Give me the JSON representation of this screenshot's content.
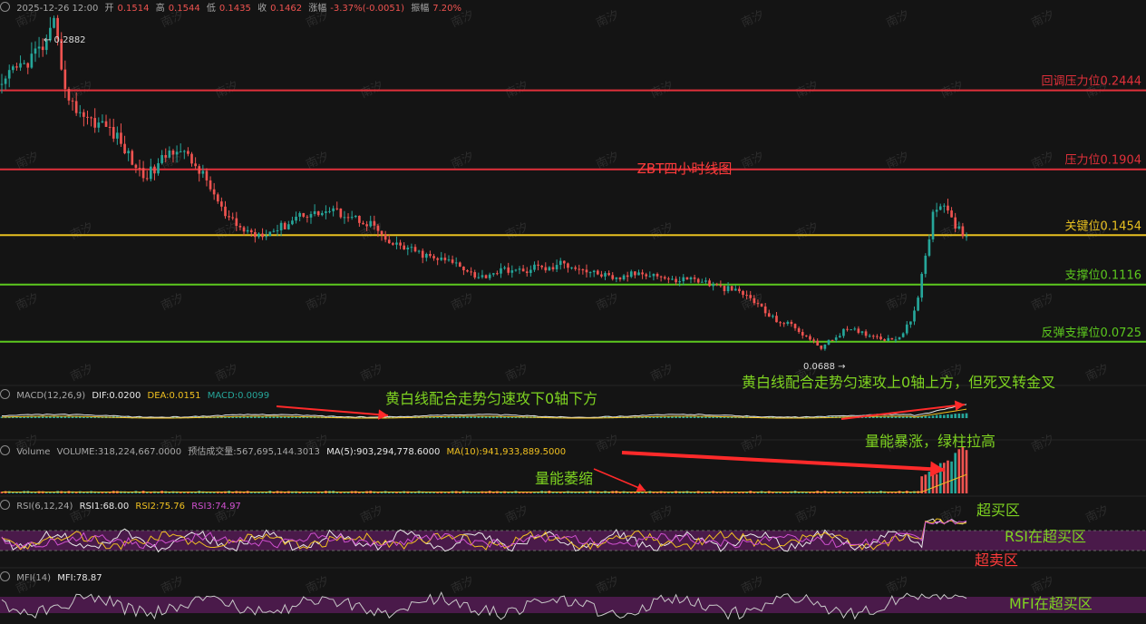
{
  "header": {
    "date": "2025-12-26 12:00",
    "open_label": "开",
    "open": "0.1514",
    "high_label": "高",
    "high": "0.1544",
    "low_label": "低",
    "low": "0.1435",
    "close_label": "收",
    "close": "0.1462",
    "change_label": "涨幅",
    "change": "-3.37%(-0.0051)",
    "amplitude_label": "振幅",
    "amplitude": "7.20%"
  },
  "title": "ZBT四小时线图",
  "watermark": "南汐",
  "price_marks": {
    "high_label": "0.2882",
    "low_label": "0.0688"
  },
  "levels": [
    {
      "label": "回调压力位0.2444",
      "value": 0.2444,
      "color": "#e0303a"
    },
    {
      "label": "压力位0.1904",
      "value": 0.1904,
      "color": "#e0303a"
    },
    {
      "label": "关键位0.1454",
      "value": 0.1454,
      "color": "#e8c020"
    },
    {
      "label": "支撑位0.1116",
      "value": 0.1116,
      "color": "#5cc81e"
    },
    {
      "label": "反弹支撑位0.0725",
      "value": 0.0725,
      "color": "#5cc81e"
    }
  ],
  "macd": {
    "name": "MACD(12,26,9)",
    "dif": "DIF:0.0200",
    "dea": "DEA:0.0151",
    "macd": "MACD:0.0099"
  },
  "volume": {
    "name": "Volume",
    "volume": "VOLUME:318,224,667.0000",
    "est": "预估成交量:567,695,144.3013",
    "ma5": "MA(5):903,294,778.6000",
    "ma10": "MA(10):941,933,889.5000"
  },
  "rsi": {
    "name": "RSI(6,12,24)",
    "rsi1": "RSI1:68.00",
    "rsi2": "RSI2:75.76",
    "rsi3": "RSI3:74.97"
  },
  "mfi": {
    "name": "MFI(14)",
    "mfi": "MFI:78.87"
  },
  "annotations": {
    "macd_left": "黄白线配合走势匀速攻下0轴下方",
    "macd_right": "黄白线配合走势匀速攻上0轴上方，但死叉转金叉",
    "vol_up": "量能暴涨，绿柱拉高",
    "vol_down": "量能萎缩",
    "overbought": "超买区",
    "rsi_over": "RSI在超买区",
    "oversold": "超卖区",
    "mfi_over": "MFI在超买区"
  },
  "colors": {
    "up": "#26a69a",
    "down": "#ef5350",
    "annotation_green": "#7ed321",
    "arrow_red": "#ff2a2a",
    "zone_purple": "#4a1a4a"
  },
  "chart_data": {
    "type": "candlestick",
    "ylim": [
      0.055,
      0.3
    ],
    "close_path": [
      [
        0,
        0.245
      ],
      [
        3,
        0.258
      ],
      [
        6,
        0.262
      ],
      [
        9,
        0.27
      ],
      [
        12,
        0.276
      ],
      [
        14,
        0.2882
      ],
      [
        16,
        0.262
      ],
      [
        18,
        0.236
      ],
      [
        21,
        0.23
      ],
      [
        24,
        0.224
      ],
      [
        28,
        0.22
      ],
      [
        31,
        0.212
      ],
      [
        35,
        0.196
      ],
      [
        38,
        0.186
      ],
      [
        41,
        0.19
      ],
      [
        44,
        0.2
      ],
      [
        47,
        0.206
      ],
      [
        50,
        0.198
      ],
      [
        53,
        0.19
      ],
      [
        56,
        0.178
      ],
      [
        60,
        0.158
      ],
      [
        64,
        0.15
      ],
      [
        68,
        0.146
      ],
      [
        72,
        0.148
      ],
      [
        76,
        0.152
      ],
      [
        80,
        0.16
      ],
      [
        84,
        0.16
      ],
      [
        88,
        0.162
      ],
      [
        92,
        0.16
      ],
      [
        96,
        0.156
      ],
      [
        100,
        0.152
      ],
      [
        103,
        0.14
      ],
      [
        107,
        0.138
      ],
      [
        111,
        0.134
      ],
      [
        115,
        0.13
      ],
      [
        119,
        0.128
      ],
      [
        122,
        0.126
      ],
      [
        125,
        0.122
      ],
      [
        128,
        0.116
      ],
      [
        132,
        0.12
      ],
      [
        136,
        0.122
      ],
      [
        140,
        0.12
      ],
      [
        143,
        0.124
      ],
      [
        147,
        0.122
      ],
      [
        150,
        0.126
      ],
      [
        154,
        0.124
      ],
      [
        158,
        0.12
      ],
      [
        162,
        0.118
      ],
      [
        164,
        0.114
      ],
      [
        168,
        0.118
      ],
      [
        172,
        0.12
      ],
      [
        176,
        0.118
      ],
      [
        180,
        0.114
      ],
      [
        184,
        0.116
      ],
      [
        188,
        0.114
      ],
      [
        192,
        0.11
      ],
      [
        196,
        0.108
      ],
      [
        200,
        0.104
      ],
      [
        203,
        0.098
      ],
      [
        206,
        0.09
      ],
      [
        209,
        0.086
      ],
      [
        212,
        0.084
      ],
      [
        215,
        0.078
      ],
      [
        218,
        0.072
      ],
      [
        220,
        0.0688
      ],
      [
        223,
        0.074
      ],
      [
        226,
        0.08
      ],
      [
        229,
        0.08
      ],
      [
        232,
        0.078
      ],
      [
        235,
        0.076
      ],
      [
        238,
        0.074
      ],
      [
        241,
        0.076
      ],
      [
        244,
        0.086
      ],
      [
        246,
        0.104
      ],
      [
        248,
        0.13
      ],
      [
        250,
        0.16
      ],
      [
        252,
        0.168
      ],
      [
        254,
        0.164
      ],
      [
        256,
        0.15
      ],
      [
        259,
        0.146
      ]
    ]
  }
}
